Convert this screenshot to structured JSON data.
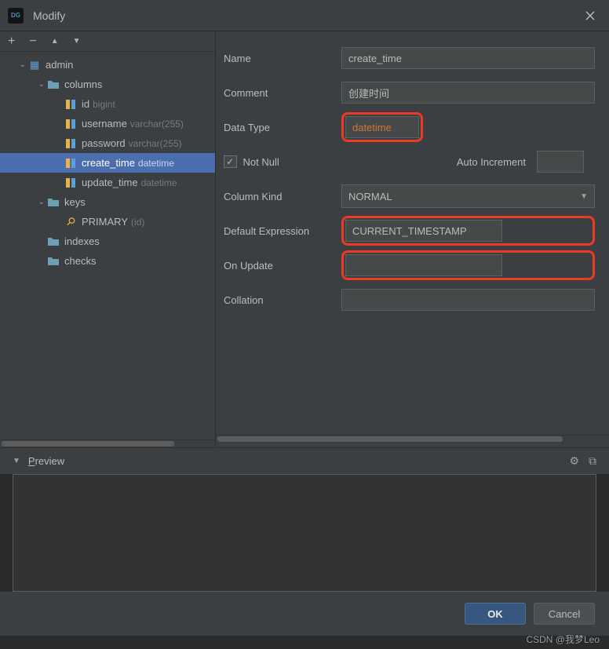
{
  "window": {
    "title": "Modify"
  },
  "toolbar": {
    "add": "+",
    "remove": "−",
    "up": "▲",
    "down": "▼"
  },
  "tree": {
    "root": {
      "name": "admin"
    },
    "columns_label": "columns",
    "columns": [
      {
        "name": "id",
        "type": "bigint"
      },
      {
        "name": "username",
        "type": "varchar(255)"
      },
      {
        "name": "password",
        "type": "varchar(255)"
      },
      {
        "name": "create_time",
        "type": "datetime"
      },
      {
        "name": "update_time",
        "type": "datetime"
      }
    ],
    "keys_label": "keys",
    "keys": [
      {
        "name": "PRIMARY",
        "note": "(id)"
      }
    ],
    "indexes_label": "indexes",
    "checks_label": "checks"
  },
  "form": {
    "name_label": "Name",
    "name_value": "create_time",
    "comment_label": "Comment",
    "comment_value": "创建时间",
    "datatype_label": "Data Type",
    "datatype_value": "datetime",
    "notnull_label": "Not Null",
    "notnull_checked": true,
    "autoinc_label": "Auto Increment",
    "autoinc_value": "",
    "kind_label": "Column Kind",
    "kind_value": "NORMAL",
    "default_label": "Default Expression",
    "default_value": "CURRENT_TIMESTAMP",
    "onupdate_label": "On Update",
    "onupdate_value": "",
    "collation_label": "Collation",
    "collation_value": ""
  },
  "preview": {
    "label_prefix": "P",
    "label_rest": "review"
  },
  "buttons": {
    "ok": "OK",
    "cancel": "Cancel"
  },
  "watermark": "CSDN @我梦Leo"
}
